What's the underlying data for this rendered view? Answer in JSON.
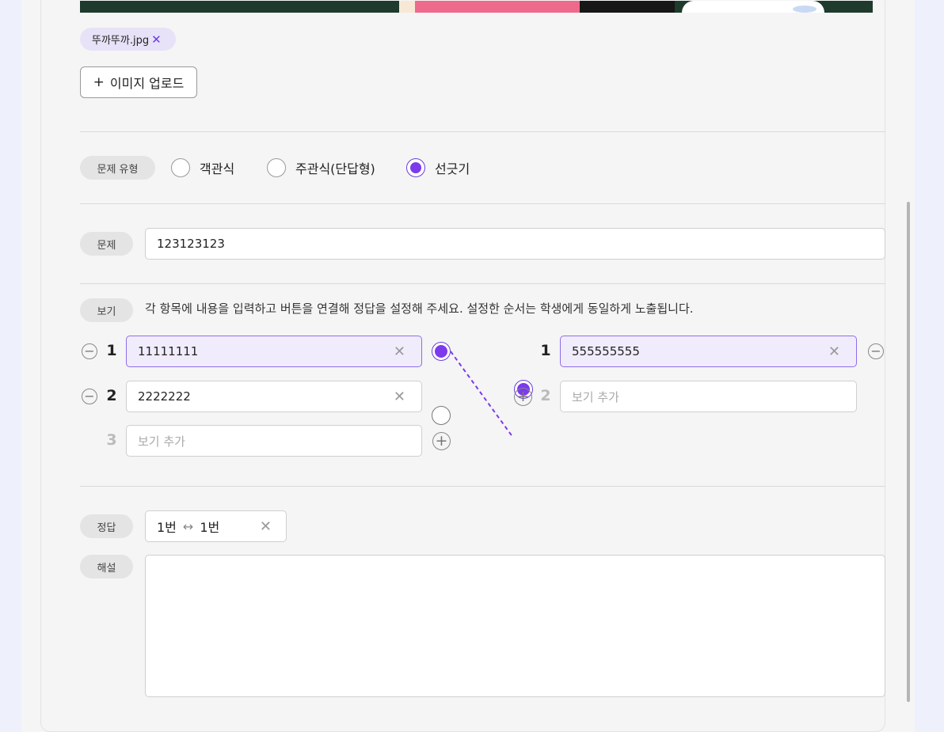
{
  "attachment": {
    "file_name": "뚜까뚜까.jpg",
    "remove_icon": "close-icon"
  },
  "upload_button": {
    "label": "이미지 업로드",
    "icon": "plus-icon"
  },
  "question_type": {
    "label": "문제 유형",
    "options": [
      {
        "label": "객관식",
        "selected": false
      },
      {
        "label": "주관식(단답형)",
        "selected": false
      },
      {
        "label": "선긋기",
        "selected": true
      }
    ]
  },
  "question": {
    "label": "문제",
    "value": "123123123"
  },
  "choices": {
    "label": "보기",
    "instruction": "각 항목에 내용을 입력하고 버튼을 연결해 정답을 설정해 주세요. 설정한 순서는 학생에게 동일하게 노출됩니다.",
    "left": [
      {
        "number": "1",
        "value": "11111111",
        "connected": true
      },
      {
        "number": "2",
        "value": "2222222",
        "connected": false
      },
      {
        "number": "3",
        "placeholder": "보기 추가"
      }
    ],
    "right": [
      {
        "number": "1",
        "value": "555555555",
        "connected": true
      },
      {
        "number": "2",
        "placeholder": "보기 추가"
      }
    ]
  },
  "answer": {
    "label": "정답",
    "left": "1번",
    "arrow": "↔",
    "right": "1번"
  },
  "explanation": {
    "label": "해설",
    "value": ""
  },
  "colors": {
    "accent": "#7c3aed",
    "active_bg": "#f1ecfc",
    "chip_bg": "#e8e2f8"
  }
}
